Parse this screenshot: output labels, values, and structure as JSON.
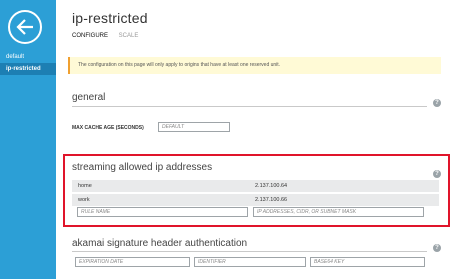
{
  "sidebar": {
    "items": [
      {
        "label": "default"
      },
      {
        "label": "ip-restricted"
      }
    ]
  },
  "header": {
    "title": "ip-restricted",
    "tabs": [
      {
        "label": "CONFIGURE"
      },
      {
        "label": "SCALE"
      }
    ]
  },
  "notice": {
    "text": "The configuration on this page will only apply to origins that have at least one reserved unit."
  },
  "general": {
    "title": "general",
    "max_cache_age_label": "MAX CACHE AGE (SECONDS)",
    "max_cache_age_placeholder": "DEFAULT"
  },
  "streaming": {
    "title": "streaming allowed ip addresses",
    "rows": [
      {
        "name": "home",
        "ip": "2.137.100.64"
      },
      {
        "name": "work",
        "ip": "2.137.100.66"
      }
    ],
    "rule_name_placeholder": "RULE NAME",
    "ip_placeholder": "IP ADDRESSES, CIDR, OR SUBNET MASK"
  },
  "akamai": {
    "title": "akamai signature header authentication",
    "expiration_placeholder": "EXPIRATION DATE",
    "identifier_placeholder": "IDENTIFIER",
    "base64_placeholder": "BASE64 KEY"
  },
  "icons": {
    "back": "back-arrow-icon",
    "help": "help-icon"
  },
  "colors": {
    "sidebar": "#2c9fd6",
    "sidebar_active": "#1d7fb3",
    "highlight": "#e0142a",
    "notice_bg": "#fffad6"
  }
}
